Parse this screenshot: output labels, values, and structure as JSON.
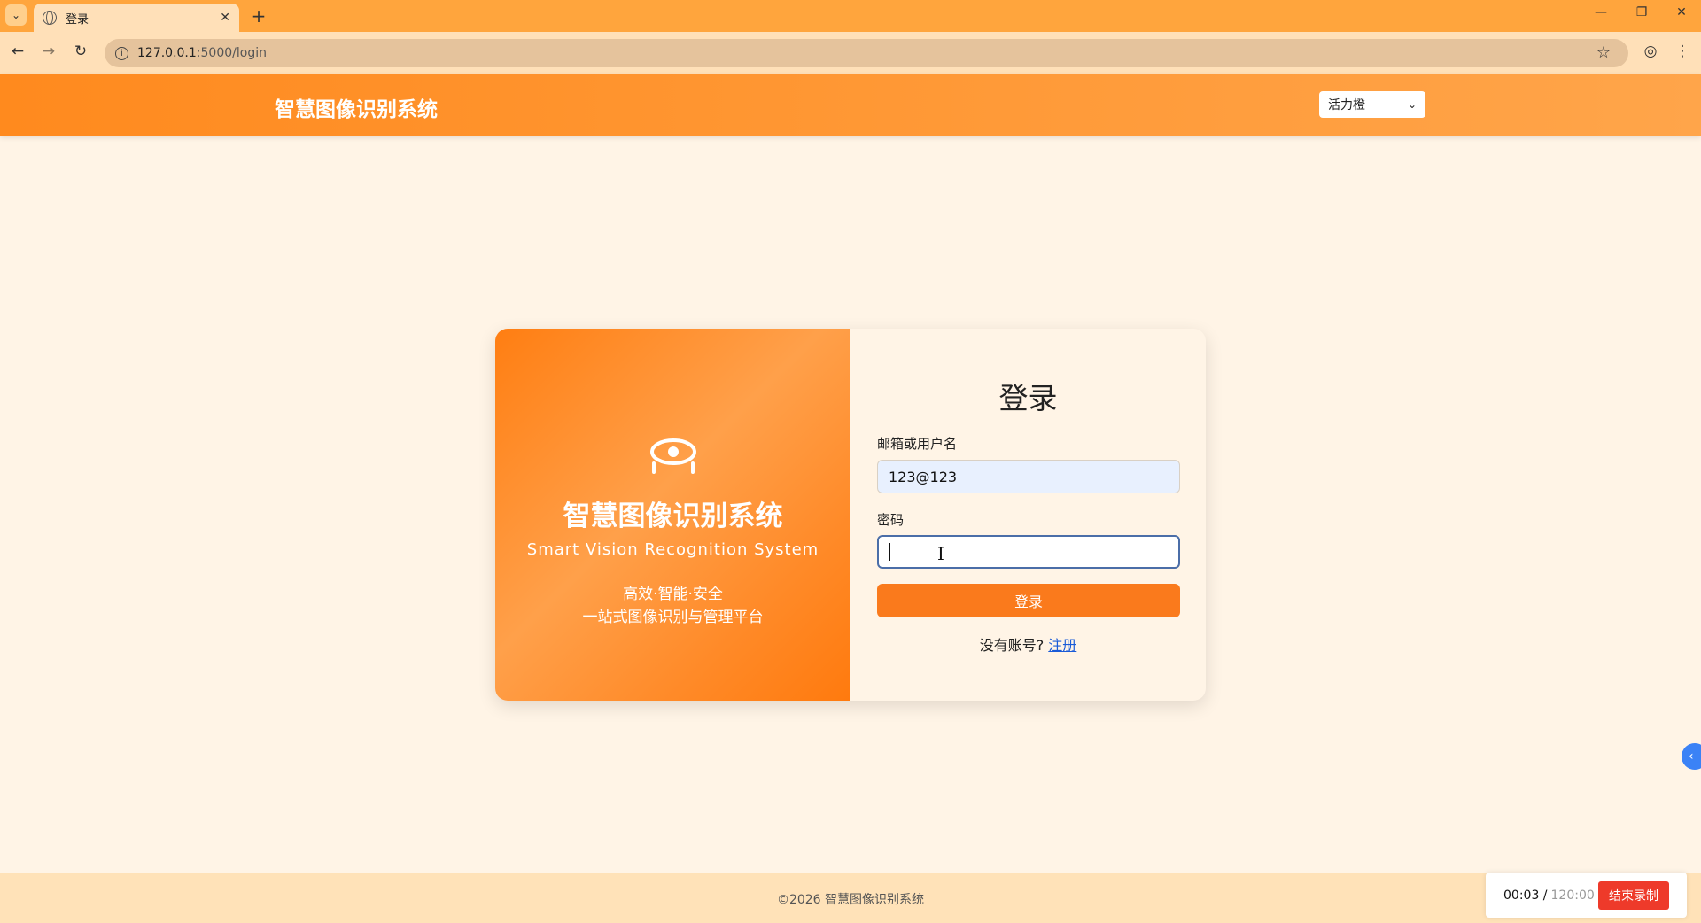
{
  "browser": {
    "tab_title": "登录",
    "url_host": "127.0.0.1",
    "url_path": ":5000/login",
    "close_glyph": "✕",
    "new_tab_glyph": "+",
    "tab_list_glyph": "⌄",
    "back_glyph": "←",
    "forward_glyph": "→",
    "reload_glyph": "↻",
    "star_glyph": "☆",
    "profile_glyph": "◎",
    "menu_glyph": "⋮",
    "minimize_glyph": "—",
    "restore_glyph": "❐",
    "window_close_glyph": "✕"
  },
  "header": {
    "site_title": "智慧图像识别系统",
    "theme_value": "活力橙",
    "theme_chevron": "⌄"
  },
  "brand_panel": {
    "title": "智慧图像识别系统",
    "subtitle": "Smart Vision Recognition System",
    "tagline1": "高效·智能·安全",
    "tagline2": "一站式图像识别与管理平台"
  },
  "login_form": {
    "title": "登录",
    "username_label": "邮箱或用户名",
    "username_value": "123@123",
    "password_label": "密码",
    "submit_label": "登录",
    "register_prompt": "没有账号?",
    "register_link": "注册"
  },
  "footer": {
    "copyright": "©2026 智慧图像识别系统"
  },
  "recorder": {
    "elapsed": "00:03 /",
    "total": "120:00",
    "stop_label": "结束录制"
  },
  "side_toggle_glyph": "‹",
  "colors": {
    "brand_orange": "#fa7a1c",
    "page_bg": "#fff4e6",
    "link_blue": "#1a5bd8"
  }
}
